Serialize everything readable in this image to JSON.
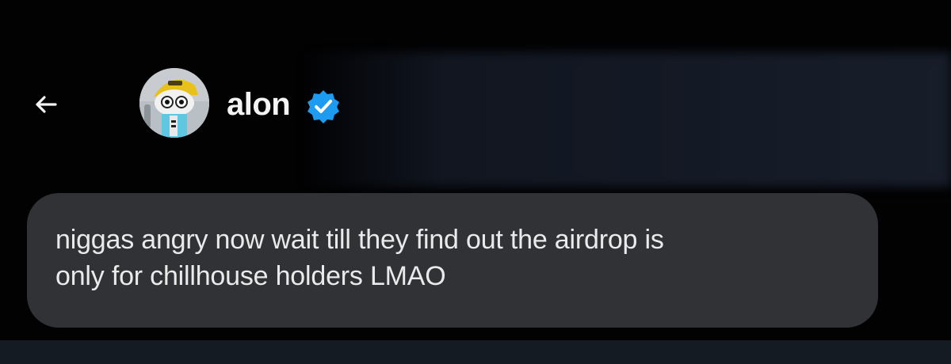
{
  "header": {
    "username": "alon",
    "verified": true,
    "verified_color": "#1d9bf0",
    "back_icon": "arrow-left-icon",
    "avatar_icon": "avatar-character-icon"
  },
  "message": {
    "line1": "niggas angry now wait till they find out the airdrop is",
    "line2": "only for chillhouse holders LMAO"
  },
  "colors": {
    "background": "#020203",
    "bubble": "#313236",
    "text": "#eaeaea",
    "bottom_strip": "#151b23"
  }
}
